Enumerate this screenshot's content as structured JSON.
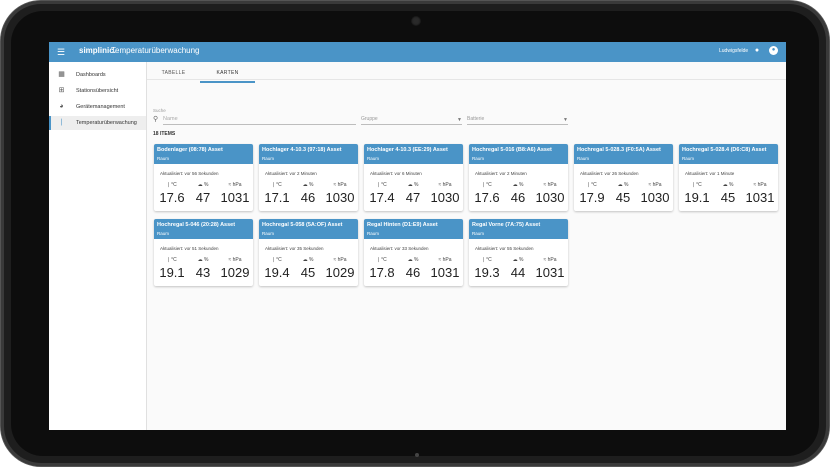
{
  "app": {
    "brand": "simplinic.",
    "title": "Temperaturüberwachung",
    "user": "Ludwigsfelde"
  },
  "sidebar": {
    "items": [
      {
        "label": "Dashboards",
        "icon": "dashboard-icon"
      },
      {
        "label": "Stationsübersicht",
        "icon": "station-icon"
      },
      {
        "label": "Gerätemanagement",
        "icon": "device-icon"
      },
      {
        "label": "Temperaturüberwachung",
        "icon": "thermometer-icon",
        "active": true
      }
    ]
  },
  "tabs": [
    {
      "label": "TABELLE",
      "active": false
    },
    {
      "label": "KARTEN",
      "active": true
    }
  ],
  "filters": {
    "search_label": "Suche",
    "search_placeholder": "Name",
    "group_label": "Gruppe",
    "battery_label": "Batterie"
  },
  "items_count": "18 ITEMS",
  "units": {
    "temp": "°C",
    "humidity": "%",
    "pressure": "hPa"
  },
  "colors": {
    "accent": "#4a94c7"
  },
  "cards": [
    {
      "title": "Bodenlager (08:78) Asset",
      "sub": "Raum",
      "updated": "Aktualisiert: vor 56 Sekunden",
      "temp": "17.6",
      "humidity": "47",
      "pressure": "1031"
    },
    {
      "title": "Hochlager 4-10.3 (97:18) Asset",
      "sub": "Raum",
      "updated": "Aktualisiert: vor 2 Minuten",
      "temp": "17.1",
      "humidity": "46",
      "pressure": "1030"
    },
    {
      "title": "Hochlager 4-10.3 (EE:29) Asset",
      "sub": "Raum",
      "updated": "Aktualisiert: vor 6 Minuten",
      "temp": "17.4",
      "humidity": "47",
      "pressure": "1030"
    },
    {
      "title": "Hochregal 5-016 (B8:A6) Asset",
      "sub": "Raum",
      "updated": "Aktualisiert: vor 2 Minuten",
      "temp": "17.6",
      "humidity": "46",
      "pressure": "1030"
    },
    {
      "title": "Hochregal 5-028.3 (F0:5A) Asset",
      "sub": "Raum",
      "updated": "Aktualisiert: vor 26 Sekunden",
      "temp": "17.9",
      "humidity": "45",
      "pressure": "1030"
    },
    {
      "title": "Hochregal 5-028.4 (D6:C8) Asset",
      "sub": "Raum",
      "updated": "Aktualisiert: vor 1 Minute",
      "temp": "19.1",
      "humidity": "45",
      "pressure": "1031"
    },
    {
      "title": "Hochregal 5-046 (20:28) Asset",
      "sub": "Raum",
      "updated": "Aktualisiert: vor 51 Sekunden",
      "temp": "19.1",
      "humidity": "43",
      "pressure": "1029"
    },
    {
      "title": "Hochregal 5-058 (5A:OF) Asset",
      "sub": "Raum",
      "updated": "Aktualisiert: vor 35 Sekunden",
      "temp": "19.4",
      "humidity": "45",
      "pressure": "1029"
    },
    {
      "title": "Regal Hinten (D1:E9) Asset",
      "sub": "Raum",
      "updated": "Aktualisiert: vor 33 Sekunden",
      "temp": "17.8",
      "humidity": "46",
      "pressure": "1031"
    },
    {
      "title": "Regal Vorne (7A:75) Asset",
      "sub": "Raum",
      "updated": "Aktualisiert: vor 55 Sekunden",
      "temp": "19.3",
      "humidity": "44",
      "pressure": "1031"
    }
  ]
}
